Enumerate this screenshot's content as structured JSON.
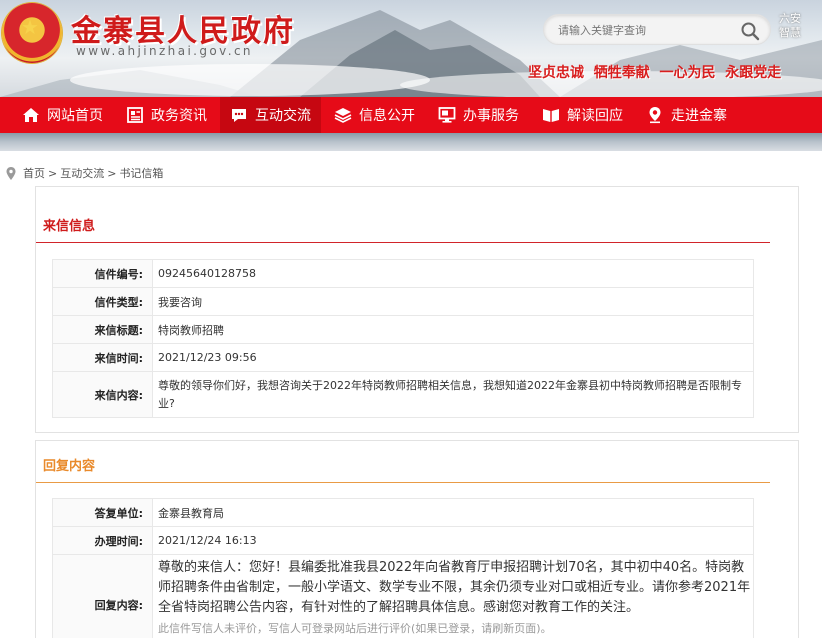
{
  "header": {
    "site_title": "金寨县人民政府",
    "site_url": "www.ahjinzhai.gov.cn",
    "search_placeholder": "请输入关键字查询",
    "region_link": "六安智慧",
    "slogan": "坚贞忠诚  牺牲奉献  一心为民  永跟党走"
  },
  "nav": {
    "items": [
      {
        "label": "网站首页",
        "icon": "home-icon"
      },
      {
        "label": "政务资讯",
        "icon": "news-icon"
      },
      {
        "label": "互动交流",
        "icon": "chat-icon",
        "active": true
      },
      {
        "label": "信息公开",
        "icon": "layers-icon"
      },
      {
        "label": "办事服务",
        "icon": "monitor-icon"
      },
      {
        "label": "解读回应",
        "icon": "book-icon"
      },
      {
        "label": "走进金寨",
        "icon": "location-icon"
      }
    ]
  },
  "breadcrumb": {
    "items": [
      "首页",
      "互动交流",
      "书记信箱"
    ],
    "separator": ">"
  },
  "letter": {
    "section_title": "来信信息",
    "rows": [
      {
        "label": "信件编号:",
        "value": "09245640128758"
      },
      {
        "label": "信件类型:",
        "value": "我要咨询"
      },
      {
        "label": "来信标题:",
        "value": "特岗教师招聘"
      },
      {
        "label": "来信时间:",
        "value": "2021/12/23 09:56"
      },
      {
        "label": "来信内容:",
        "value": "尊敬的领导你们好，我想咨询关于2022年特岗教师招聘相关信息，我想知道2022年金寨县初中特岗教师招聘是否限制专业?"
      }
    ]
  },
  "reply": {
    "section_title": "回复内容",
    "rows": [
      {
        "label": "答复单位:",
        "value": "金寨县教育局"
      },
      {
        "label": "办理时间:",
        "value": "2021/12/24 16:13"
      },
      {
        "label": "回复内容:",
        "value": "尊敬的来信人：您好！县编委批准我县2022年向省教育厅申报招聘计划70名，其中初中40名。特岗教师招聘条件由省制定，一般小学语文、数学专业不限，其余仍须专业对口或相近专业。请你参考2021年全省特岗招聘公告内容，有针对性的了解招聘具体信息。感谢您对教育工作的关注。"
      }
    ],
    "note": "此信件写信人未评价，写信人可登录网站后进行评价(如果已登录，请刷新页面)。"
  },
  "colors": {
    "nav_red": "#e60b18",
    "title_red": "#cf1b1b",
    "reply_orange": "#e98a2b"
  }
}
